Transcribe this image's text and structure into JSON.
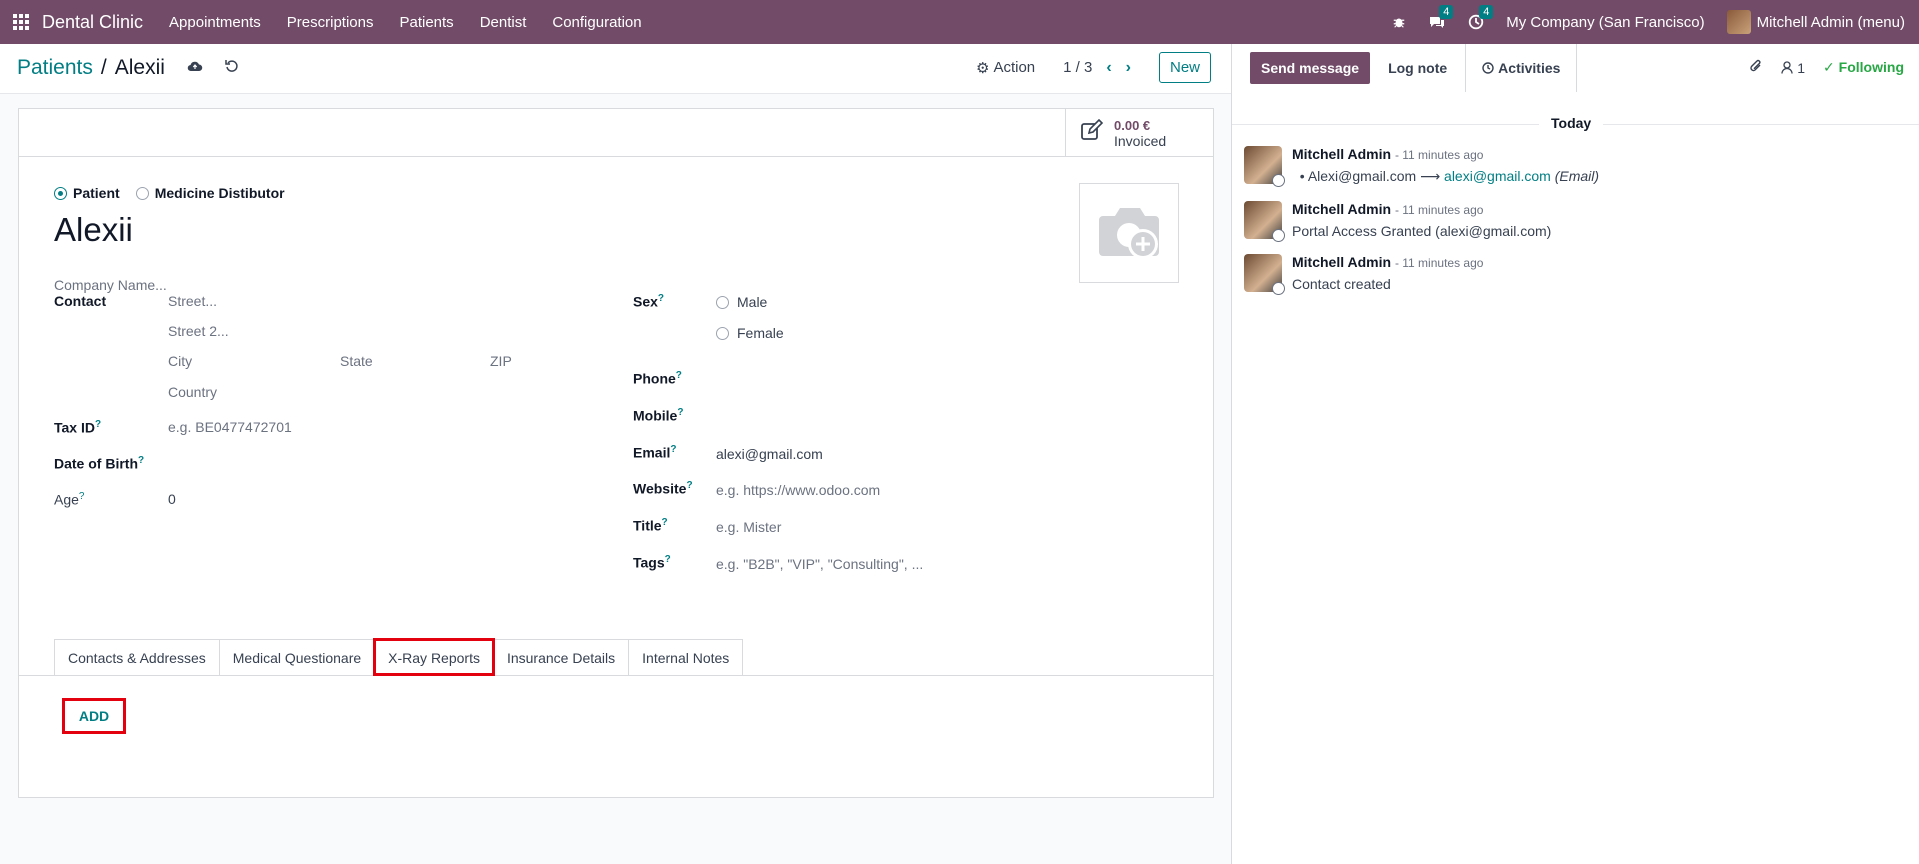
{
  "navbar": {
    "brand": "Dental Clinic",
    "menu": [
      "Appointments",
      "Prescriptions",
      "Patients",
      "Dentist",
      "Configuration"
    ],
    "bug_icon": "bug-icon",
    "messages_badge": "4",
    "activities_badge": "4",
    "company": "My Company (San Francisco)",
    "user": "Mitchell Admin (menu)"
  },
  "control": {
    "breadcrumb_parent": "Patients",
    "breadcrumb_sep": "/",
    "breadcrumb_current": "Alexii",
    "action_label": "Action",
    "pager": "1 / 3",
    "new_label": "New"
  },
  "stat": {
    "value": "0.00 €",
    "label": "Invoiced"
  },
  "form": {
    "type_patient": "Patient",
    "type_distributor": "Medicine Distibutor",
    "name": "Alexii",
    "company_placeholder": "Company Name...",
    "contact_label": "Contact",
    "street_ph": "Street...",
    "street2_ph": "Street 2...",
    "city_ph": "City",
    "state_ph": "State",
    "zip_ph": "ZIP",
    "country_ph": "Country",
    "tax_label": "Tax ID",
    "tax_ph": "e.g. BE0477472701",
    "dob_label": "Date of Birth",
    "age_label": "Age",
    "age_value": "0",
    "sex_label": "Sex",
    "sex_male": "Male",
    "sex_female": "Female",
    "phone_label": "Phone",
    "mobile_label": "Mobile",
    "email_label": "Email",
    "email_value": "alexi@gmail.com",
    "website_label": "Website",
    "website_ph": "e.g. https://www.odoo.com",
    "title_label": "Title",
    "title_ph": "e.g. Mister",
    "tags_label": "Tags",
    "tags_ph": "e.g. \"B2B\", \"VIP\", \"Consulting\", ...",
    "help_mark": "?"
  },
  "tabs": [
    "Contacts & Addresses",
    "Medical Questionare",
    "X-Ray Reports",
    "Insurance Details",
    "Internal Notes"
  ],
  "add_label": "ADD",
  "chatter": {
    "send_message": "Send message",
    "log_note": "Log note",
    "activities": "Activities",
    "followers_count": "1",
    "following": "Following",
    "today": "Today",
    "messages": [
      {
        "author": "Mitchell Admin",
        "time": "- 11 minutes ago",
        "old": "Alexi@gmail.com",
        "arrow": "⟶",
        "new": "alexi@gmail.com",
        "field": "(Email)"
      },
      {
        "author": "Mitchell Admin",
        "time": "- 11 minutes ago",
        "body": "Portal Access Granted (alexi@gmail.com)"
      },
      {
        "author": "Mitchell Admin",
        "time": "- 11 minutes ago",
        "body": "Contact created"
      }
    ]
  },
  "colors": {
    "brand": "#714B67",
    "accent": "#017e84",
    "highlight": "#e3000f",
    "following": "#28a745"
  }
}
